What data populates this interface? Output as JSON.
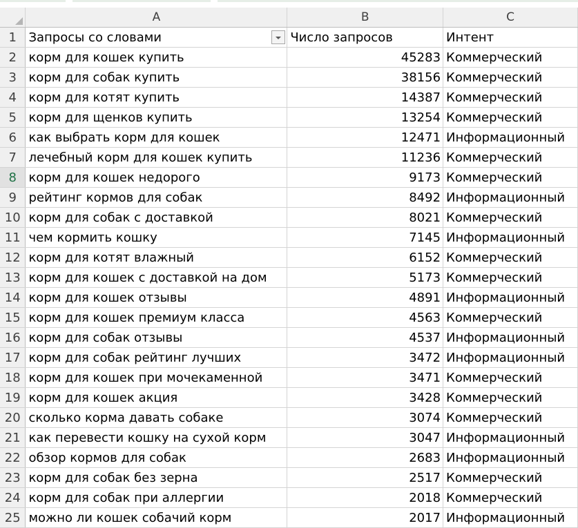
{
  "sheet": {
    "columns": [
      "A",
      "B",
      "C"
    ],
    "header_row": {
      "number": "1",
      "a": "Запросы со словами",
      "b": "Число запросов",
      "c": "Интент"
    },
    "active_row": "8",
    "rows": [
      {
        "n": "2",
        "query": "корм для кошек купить",
        "count": "45283",
        "intent": "Коммерческий"
      },
      {
        "n": "3",
        "query": "корм для собак купить",
        "count": "38156",
        "intent": "Коммерческий"
      },
      {
        "n": "4",
        "query": "корм для котят купить",
        "count": "14387",
        "intent": "Коммерческий"
      },
      {
        "n": "5",
        "query": "корм для щенков купить",
        "count": "13254",
        "intent": "Коммерческий"
      },
      {
        "n": "6",
        "query": "как выбрать корм для кошек",
        "count": "12471",
        "intent": "Информационный"
      },
      {
        "n": "7",
        "query": "лечебный корм для кошек купить",
        "count": "11236",
        "intent": "Коммерческий"
      },
      {
        "n": "8",
        "query": "корм для кошек недорого",
        "count": "9173",
        "intent": "Коммерческий"
      },
      {
        "n": "9",
        "query": "рейтинг кормов для собак",
        "count": "8492",
        "intent": "Информационный"
      },
      {
        "n": "10",
        "query": "корм для собак с доставкой",
        "count": "8021",
        "intent": "Коммерческий"
      },
      {
        "n": "11",
        "query": "чем кормить кошку",
        "count": "7145",
        "intent": "Информационный"
      },
      {
        "n": "12",
        "query": "корм для котят влажный",
        "count": "6152",
        "intent": "Коммерческий"
      },
      {
        "n": "13",
        "query": "корм для кошек с доставкой на дом",
        "count": "5173",
        "intent": "Коммерческий"
      },
      {
        "n": "14",
        "query": "корм для кошек отзывы",
        "count": "4891",
        "intent": "Информационный"
      },
      {
        "n": "15",
        "query": "корм для кошек премиум класса",
        "count": "4563",
        "intent": "Коммерческий"
      },
      {
        "n": "16",
        "query": "корм для собак отзывы",
        "count": "4537",
        "intent": "Информационный"
      },
      {
        "n": "17",
        "query": "корм для собак рейтинг лучших",
        "count": "3472",
        "intent": "Информационный"
      },
      {
        "n": "18",
        "query": "корм для кошек при мочекаменной",
        "count": "3471",
        "intent": "Коммерческий"
      },
      {
        "n": "19",
        "query": "корм для кошек акция",
        "count": "3428",
        "intent": "Коммерческий"
      },
      {
        "n": "20",
        "query": "сколько корма давать собаке",
        "count": "3074",
        "intent": "Коммерческий"
      },
      {
        "n": "21",
        "query": "как перевести кошку на сухой корм",
        "count": "3047",
        "intent": "Информационный"
      },
      {
        "n": "22",
        "query": "обзор кормов для собак",
        "count": "2683",
        "intent": "Информационный"
      },
      {
        "n": "23",
        "query": "корм для собак без зерна",
        "count": "2517",
        "intent": "Коммерческий"
      },
      {
        "n": "24",
        "query": "корм для собак при аллергии",
        "count": "2018",
        "intent": "Коммерческий"
      },
      {
        "n": "25",
        "query": "можно ли кошек собачий корм",
        "count": "2017",
        "intent": "Информационный"
      }
    ]
  },
  "icons": {
    "corner": "select-all-triangle-icon",
    "filter": "filter-dropdown-icon"
  },
  "colors": {
    "active_row_header": "#1f7145",
    "header_bg": "#f0f0f0",
    "gridline": "#d4d4d4"
  }
}
